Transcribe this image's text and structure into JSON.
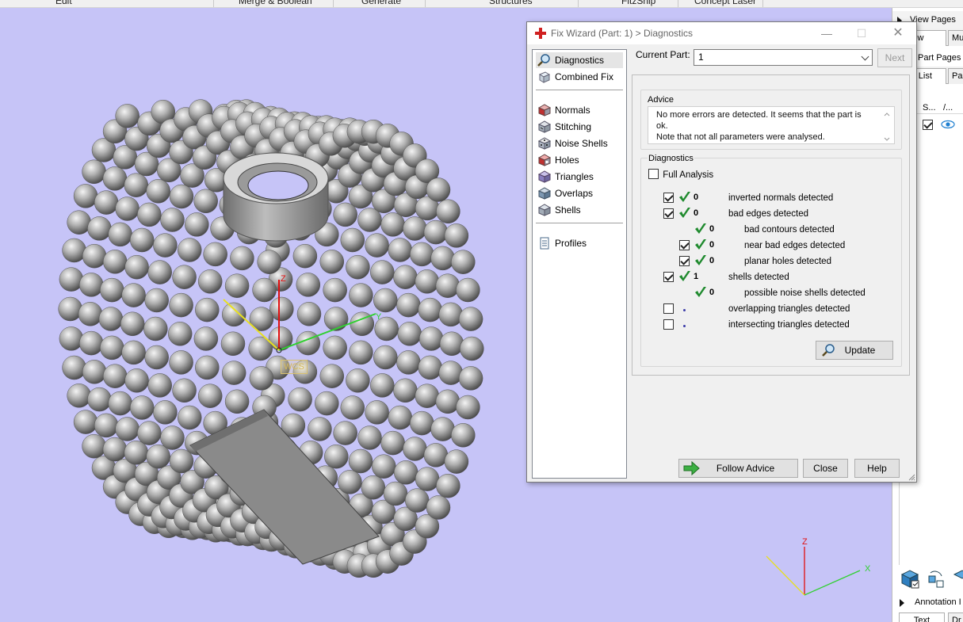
{
  "menubar": {
    "items": [
      "Edit",
      "Merge & Boolean",
      "Generate",
      "Structures",
      "FitzShip",
      "Concept Laser"
    ]
  },
  "viewport": {
    "background_color": "#c6c4f7",
    "wcs_label": "WCS",
    "axis_z": "Z",
    "axis_y": "Y",
    "axis_x": "X",
    "mini_axis_z": "Z",
    "mini_axis_x": "X"
  },
  "right_panel": {
    "view_pages": "View Pages",
    "tab_view": "iew",
    "tab_mu": "Mu",
    "part_pages": "Part Pages",
    "tab_part_list": "rt List",
    "tab_pa": "Pa",
    "col_s": "S...",
    "col_slash": "/...",
    "annotation": "Annotation I",
    "tab_text": "Text",
    "tab_dr": "Dr"
  },
  "dialog": {
    "title": "Fix Wizard (Part: 1) > Diagnostics",
    "window_controls": {
      "minimize": "—",
      "maximize": "☐",
      "close": "✕"
    },
    "nav": [
      {
        "label": "Diagnostics",
        "icon": "magnifier-icon",
        "selected": true
      },
      {
        "label": "Combined Fix",
        "icon": "combined-fix-icon"
      },
      {
        "label": "Normals",
        "icon": "normals-icon"
      },
      {
        "label": "Stitching",
        "icon": "stitching-icon"
      },
      {
        "label": "Noise Shells",
        "icon": "noise-shells-icon"
      },
      {
        "label": "Holes",
        "icon": "holes-icon"
      },
      {
        "label": "Triangles",
        "icon": "triangles-icon"
      },
      {
        "label": "Overlaps",
        "icon": "overlaps-icon"
      },
      {
        "label": "Shells",
        "icon": "shells-icon"
      },
      {
        "label": "Profiles",
        "icon": "profiles-icon"
      }
    ],
    "current_part_label": "Current Part:",
    "current_part_value": "1",
    "next_button": "Next",
    "advice": {
      "heading": "Advice",
      "text_line1": "No more errors are detected. It seems that the part is ok.",
      "text_line2": "Note that not all parameters were analysed."
    },
    "diagnostics": {
      "heading": "Diagnostics",
      "full_analysis_label": "Full Analysis",
      "full_analysis_checked": false,
      "rows": [
        {
          "checked": true,
          "has_checkbox": true,
          "status": "ok",
          "count": "0",
          "label": "inverted normals detected",
          "indent": 0
        },
        {
          "checked": true,
          "has_checkbox": true,
          "status": "ok",
          "count": "0",
          "label": "bad edges detected",
          "indent": 0
        },
        {
          "checked": false,
          "has_checkbox": false,
          "status": "ok",
          "count": "0",
          "label": "bad contours detected",
          "indent": 1
        },
        {
          "checked": true,
          "has_checkbox": true,
          "status": "ok",
          "count": "0",
          "label": "near bad edges detected",
          "indent": 1
        },
        {
          "checked": true,
          "has_checkbox": true,
          "status": "ok",
          "count": "0",
          "label": "planar holes detected",
          "indent": 1
        },
        {
          "checked": true,
          "has_checkbox": true,
          "status": "ok",
          "count": "1",
          "label": "shells detected",
          "indent": 0
        },
        {
          "checked": false,
          "has_checkbox": false,
          "status": "ok",
          "count": "0",
          "label": "possible noise shells detected",
          "indent": 1
        },
        {
          "checked": false,
          "has_checkbox": true,
          "status": "none",
          "count": "",
          "label": "overlapping triangles detected",
          "indent": 0
        },
        {
          "checked": false,
          "has_checkbox": true,
          "status": "none",
          "count": "",
          "label": "intersecting triangles detected",
          "indent": 0
        }
      ],
      "update_button": "Update"
    },
    "follow_advice_button": "Follow Advice",
    "close_button": "Close",
    "help_button": "Help"
  },
  "colors": {
    "check_green": "#1f8a2e",
    "x_axis": "#30d030",
    "y_axis": "#e8e020",
    "z_axis": "#e01010",
    "sphere": "#a8a8a8"
  }
}
